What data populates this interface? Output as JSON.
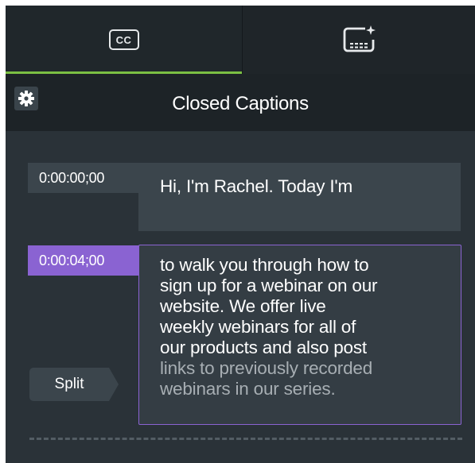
{
  "tabs": [
    {
      "icon": "closed-captions-icon",
      "glyph": "CC",
      "active": true
    },
    {
      "icon": "caption-edit-icon",
      "active": false
    }
  ],
  "colors": {
    "active_tab_accent": "#7bc043",
    "selected_accent": "#8a63d2",
    "panel_bg": "#2a3238"
  },
  "header": {
    "title": "Closed Captions",
    "settings_icon": "gear-icon"
  },
  "captions": [
    {
      "timestamp": "0:00:00;00",
      "text": "Hi, I'm Rachel. Today I'm",
      "selected": false
    },
    {
      "timestamp": "0:00:04;00",
      "selected": true,
      "lines": [
        "to walk you through how to",
        "sign up for a webinar on our",
        "website. We offer live",
        "weekly webinars for all of",
        "our products and also post"
      ],
      "overflow_lines": [
        "links to previously recorded",
        "webinars in our series."
      ]
    }
  ],
  "split_button": {
    "label": "Split"
  }
}
